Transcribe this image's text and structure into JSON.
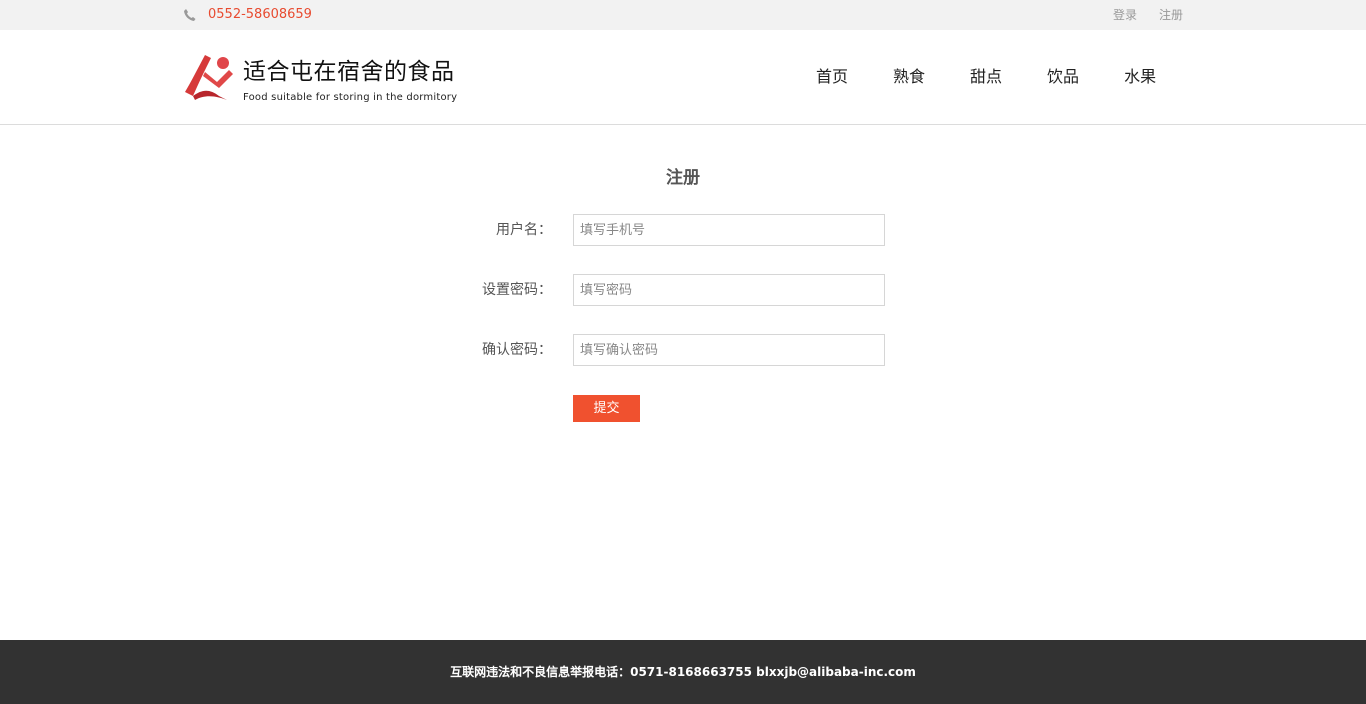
{
  "topbar": {
    "phone_icon": "phone-icon",
    "phone": "0552-58608659",
    "login_label": "登录",
    "register_label": "注册"
  },
  "header": {
    "logo_icon": "brand-logo",
    "title": "适合屯在宿舍的食品",
    "subtitle": "Food suitable for storing in the dormitory",
    "nav": [
      {
        "label": "首页"
      },
      {
        "label": "熟食"
      },
      {
        "label": "甜点"
      },
      {
        "label": "饮品"
      },
      {
        "label": "水果"
      }
    ]
  },
  "form": {
    "title": "注册",
    "username": {
      "label": "用户名：",
      "placeholder": "填写手机号",
      "value": ""
    },
    "password": {
      "label": "设置密码：",
      "placeholder": "填写密码",
      "value": ""
    },
    "confirm": {
      "label": "确认密码：",
      "placeholder": "填写确认密码",
      "value": ""
    },
    "submit_label": "提交"
  },
  "footer": {
    "text": "互联网违法和不良信息举报电话：0571-8168663755 blxxjb@alibaba-inc.com"
  },
  "colors": {
    "accent": "#f0512f",
    "phone_text": "#e84b30",
    "footer_bg": "#323232",
    "topbar_bg": "#f2f2f2"
  }
}
